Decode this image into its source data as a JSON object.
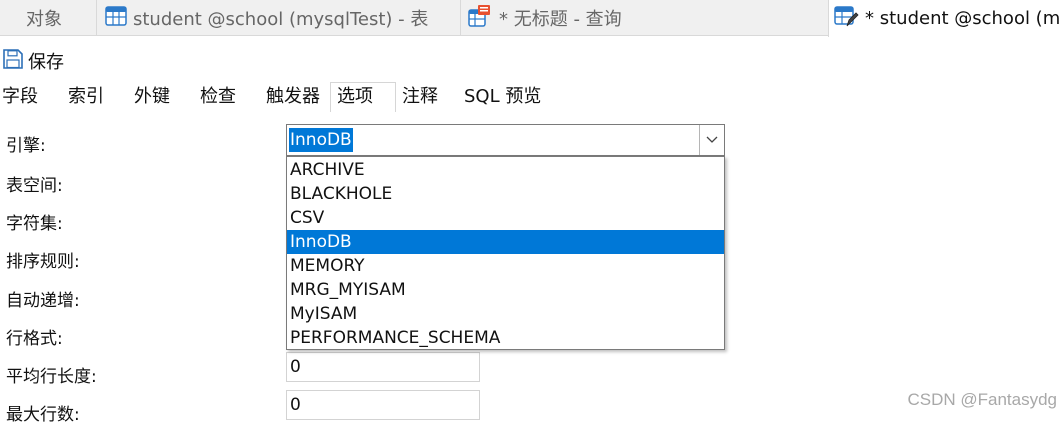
{
  "tabs": {
    "objects": "对象",
    "table_tab": "student @school (mysqlTest) - 表",
    "query_tab": "* 无标题 - 查询",
    "design_tab": "* student @school (mys"
  },
  "toolbar": {
    "save_label": "保存"
  },
  "subtabs": [
    "字段",
    "索引",
    "外键",
    "检查",
    "触发器",
    "选项",
    "注释",
    "SQL 预览"
  ],
  "form": {
    "engine_label": "引擎:",
    "tablespace_label": "表空间:",
    "charset_label": "字符集:",
    "collation_label": "排序规则:",
    "auto_increment_label": "自动递增:",
    "row_format_label": "行格式:",
    "avg_row_length_label": "平均行长度:",
    "max_rows_label": "最大行数:",
    "avg_row_length_value": "0",
    "max_rows_value": "0"
  },
  "engine": {
    "selected": "InnoDB",
    "options": [
      "ARCHIVE",
      "BLACKHOLE",
      "CSV",
      "InnoDB",
      "MEMORY",
      "MRG_MYISAM",
      "MyISAM",
      "PERFORMANCE_SCHEMA"
    ]
  },
  "watermark": "CSDN @Fantasydg",
  "colors": {
    "selection": "#0078d7",
    "tab_background": "#f0f0f0"
  }
}
